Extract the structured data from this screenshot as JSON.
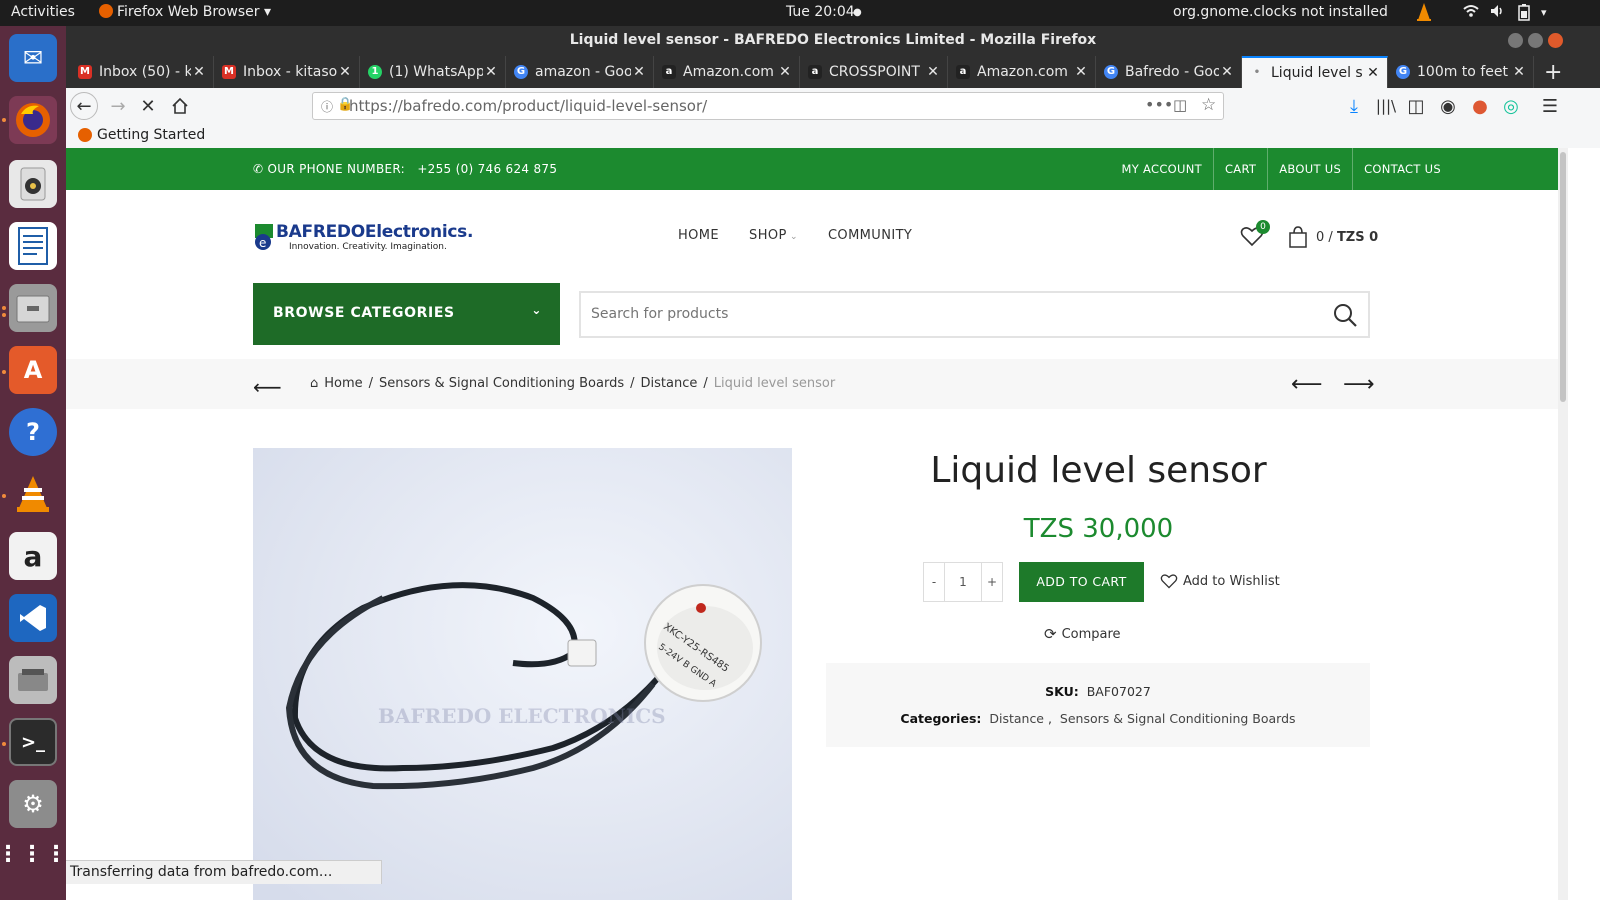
{
  "topbar": {
    "activities": "Activities",
    "app_name": "Firefox Web Browser",
    "clock": "Tue 20:04",
    "notification": "org.gnome.clocks not installed"
  },
  "window": {
    "title": "Liquid level sensor - BAFREDO Electronics Limited - Mozilla Firefox"
  },
  "tabs": [
    {
      "label": "Inbox (50) - k",
      "icon": "gmail-icon",
      "color": "#d93025"
    },
    {
      "label": "Inbox - kitaso",
      "icon": "gmail-icon",
      "color": "#d93025"
    },
    {
      "label": "(1) WhatsApp",
      "icon": "whatsapp-icon",
      "color": "#25d366"
    },
    {
      "label": "amazon - Goo",
      "icon": "google-icon",
      "color": "#4285f4"
    },
    {
      "label": "Amazon.com",
      "icon": "amazon-icon",
      "color": "#222222"
    },
    {
      "label": "CROSSPOINT",
      "icon": "amazon-icon",
      "color": "#222222"
    },
    {
      "label": "Amazon.com",
      "icon": "amazon-icon",
      "color": "#222222"
    },
    {
      "label": "Bafredo - Goo",
      "icon": "google-icon",
      "color": "#4285f4"
    },
    {
      "label": "Liquid level s",
      "icon": "loading-dot-icon",
      "color": "#888888"
    },
    {
      "label": "100m to feet",
      "icon": "google-icon",
      "color": "#4285f4"
    }
  ],
  "nav": {
    "url": "https://bafredo.com/product/liquid-level-sensor/",
    "bookmark": "Getting Started"
  },
  "site": {
    "phone_label": "OUR PHONE NUMBER:",
    "phone": "+255 (0) 746 624 875",
    "top_links": [
      "MY ACCOUNT",
      "CART",
      "ABOUT US",
      "CONTACT US"
    ],
    "logo_name": "BAFREDOElectronics.",
    "logo_tagline": "Innovation. Creativity. Imagination.",
    "menu": [
      "HOME",
      "SHOP",
      "COMMUNITY"
    ],
    "wishlist_count": "0",
    "cart_summary": "0 /",
    "cart_total": "TZS 0",
    "browse_label": "BROWSE CATEGORIES",
    "search_placeholder": "Search for products"
  },
  "breadcrumb": {
    "items": [
      "Home",
      "Sensors & Signal Conditioning Boards",
      "Distance"
    ],
    "current": "Liquid level sensor"
  },
  "product": {
    "title": "Liquid level sensor",
    "price": "TZS 30,000",
    "qty_minus": "-",
    "qty": "1",
    "qty_plus": "+",
    "add_to_cart": "ADD TO CART",
    "wishlist": "Add to Wishlist",
    "compare": "Compare",
    "sku_label": "SKU:",
    "sku": "BAF07027",
    "categories_label": "Categories:",
    "categories": [
      "Distance",
      "Sensors & Signal Conditioning Boards"
    ],
    "watermark": "BAFREDO ELECTRONICS",
    "sensor_label_1": "XKC-Y25-RS485",
    "sensor_label_2": "5-24V B GND A"
  },
  "status": "Transferring data from bafredo.com..."
}
